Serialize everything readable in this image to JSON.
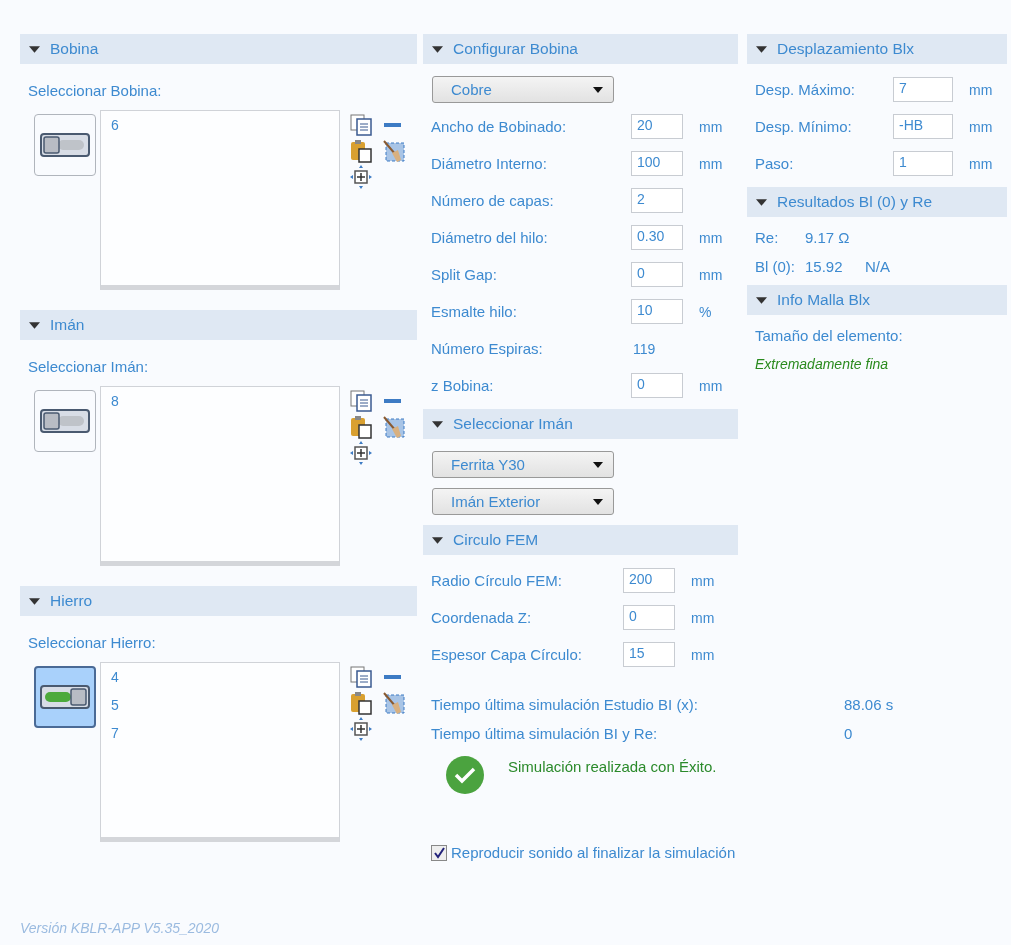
{
  "left_panels": [
    {
      "title": "Bobina",
      "label": "Seleccionar Bobina:",
      "switch_on": false,
      "items": [
        "6"
      ]
    },
    {
      "title": "Imán",
      "label": "Seleccionar Imán:",
      "switch_on": false,
      "items": [
        "8"
      ]
    },
    {
      "title": "Hierro",
      "label": "Seleccionar Hierro:",
      "switch_on": true,
      "items": [
        "4",
        "5",
        "7"
      ]
    }
  ],
  "config": {
    "title": "Configurar Bobina",
    "dropdown": "Cobre",
    "rows": [
      {
        "kind": "field",
        "label": "Ancho de Bobinado:",
        "value": "20",
        "unit": "mm"
      },
      {
        "kind": "field",
        "label": "Diámetro Interno:",
        "value": "100",
        "unit": "mm"
      },
      {
        "kind": "field",
        "label": "Número de capas:",
        "value": "2"
      },
      {
        "kind": "field",
        "label": "Diámetro del hilo:",
        "value": "0.30",
        "unit": "mm"
      },
      {
        "kind": "field",
        "label": "Split Gap:",
        "value": "0",
        "unit": "mm"
      },
      {
        "kind": "field",
        "label": "Esmalte hilo:",
        "value": "10",
        "unit": "%"
      },
      {
        "kind": "value",
        "label": "Número Espiras:",
        "value": "119"
      },
      {
        "kind": "field",
        "label": "z Bobina:",
        "value": "0",
        "unit": "mm"
      }
    ]
  },
  "iman": {
    "title": "Seleccionar Imán",
    "dropdowns": [
      "Ferrita Y30",
      "Imán Exterior"
    ]
  },
  "fem": {
    "title": "Circulo FEM",
    "rows": [
      {
        "label": "Radio Círculo FEM:",
        "value": "200",
        "unit": "mm"
      },
      {
        "label": "Coordenada Z:",
        "value": "0",
        "unit": "mm"
      },
      {
        "label": "Espesor Capa Círculo:",
        "value": "15",
        "unit": "mm"
      }
    ]
  },
  "times": [
    {
      "label": "Tiempo última simulación Estudio BI (x):",
      "value": "88.06 s"
    },
    {
      "label": "Tiempo última simulación BI y Re:",
      "value": "0"
    }
  ],
  "status": {
    "success": true,
    "message": "Simulación realizada con Éxito."
  },
  "sound": {
    "label": "Reproducir sonido al finalizar la simulación",
    "checked": true
  },
  "desplazamiento": {
    "title": "Desplazamiento Blx",
    "rows": [
      {
        "label": "Desp. Máximo:",
        "value": "7",
        "unit": "mm"
      },
      {
        "label": "Desp. Mínimo:",
        "value": "-HB",
        "unit": "mm"
      },
      {
        "label": "Paso:",
        "value": "1",
        "unit": "mm"
      }
    ]
  },
  "resultados": {
    "title": "Resultados Bl (0) y Re",
    "rows": [
      {
        "label": "Re:",
        "value": "9.17 Ω"
      },
      {
        "label": "Bl (0):",
        "value": "15.92",
        "extra": "N/A"
      }
    ]
  },
  "malla": {
    "title": "Info Malla Blx",
    "label": "Tamaño del elemento:",
    "value": "Extremadamente fina"
  },
  "version": "Versión KBLR-APP V5.35_2020"
}
